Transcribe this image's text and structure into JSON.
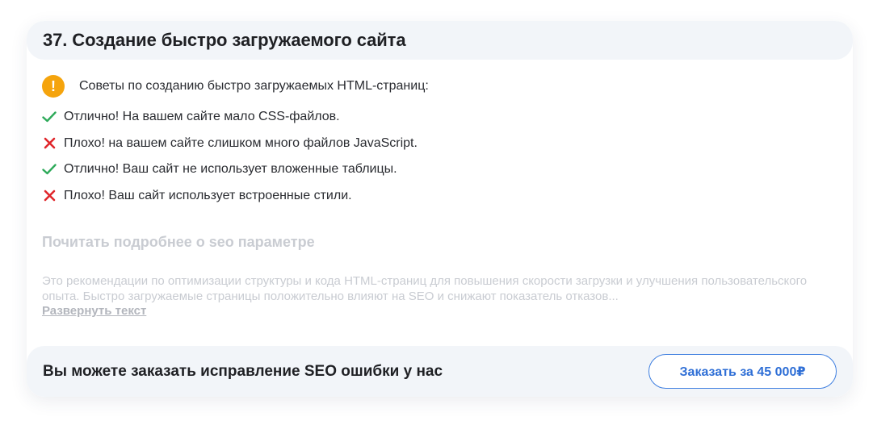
{
  "card": {
    "title": "37. Создание быстро загружаемого сайта"
  },
  "tips": {
    "heading": "Советы по созданию быстро загружаемых HTML-страниц:",
    "heading_icon": "warning-icon",
    "items": [
      {
        "status": "ok",
        "icon": "check-icon",
        "text": "Отлично! На вашем сайте мало CSS-файлов."
      },
      {
        "status": "bad",
        "icon": "cross-icon",
        "text": "Плохо! на вашем сайте слишком много файлов JavaScript."
      },
      {
        "status": "ok",
        "icon": "check-icon",
        "text": "Отлично! Ваш сайт не использует вложенные таблицы."
      },
      {
        "status": "bad",
        "icon": "cross-icon",
        "text": "Плохо! Ваш сайт использует встроенные стили."
      }
    ]
  },
  "more": {
    "title": "Почитать подробнее о seo параметре",
    "description": "Это рекомендации по оптимизации структуры и кода HTML-страниц для повышения скорости загрузки и улучшения пользовательского опыта. Быстро загружаемые страницы положительно влияют на SEO и снижают показатель отказов...",
    "expand_label": "Развернуть текст"
  },
  "footer": {
    "text": "Вы можете заказать исправление SEO ошибки у нас",
    "button_label": "Заказать за 45 000₽"
  },
  "colors": {
    "warning": "#f5a40d",
    "ok": "#2eaa5a",
    "bad": "#e0262b",
    "accent": "#3f7fe0"
  }
}
